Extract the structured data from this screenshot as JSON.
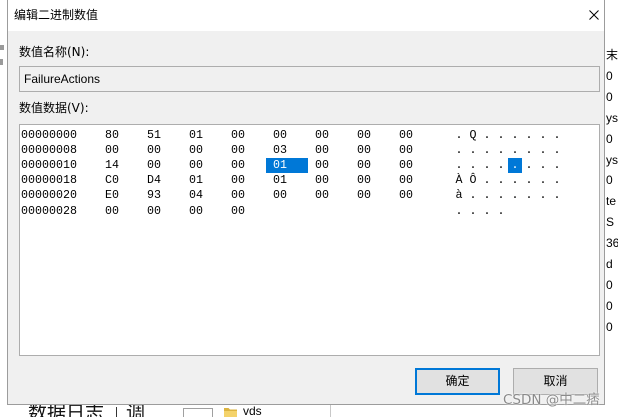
{
  "dialog": {
    "title": "编辑二进制数值",
    "close_icon": "close-icon",
    "value_name_label": "数值名称(N):",
    "value_name": "FailureActions",
    "value_data_label": "数值数据(V):",
    "ok_label": "确定",
    "cancel_label": "取消"
  },
  "hex_editor": {
    "selected": {
      "row": 2,
      "byte": 4
    },
    "rows": [
      {
        "offset": "00000000",
        "bytes": [
          "80",
          "51",
          "01",
          "00",
          "00",
          "00",
          "00",
          "00"
        ],
        "ascii": [
          ".",
          "Q",
          ".",
          ".",
          ".",
          ".",
          ".",
          "."
        ]
      },
      {
        "offset": "00000008",
        "bytes": [
          "00",
          "00",
          "00",
          "00",
          "03",
          "00",
          "00",
          "00"
        ],
        "ascii": [
          ".",
          ".",
          ".",
          ".",
          ".",
          ".",
          ".",
          "."
        ]
      },
      {
        "offset": "00000010",
        "bytes": [
          "14",
          "00",
          "00",
          "00",
          "01",
          "00",
          "00",
          "00"
        ],
        "ascii": [
          ".",
          ".",
          ".",
          ".",
          ".",
          ".",
          ".",
          "."
        ]
      },
      {
        "offset": "00000018",
        "bytes": [
          "C0",
          "D4",
          "01",
          "00",
          "01",
          "00",
          "00",
          "00"
        ],
        "ascii": [
          "À",
          "Ô",
          ".",
          ".",
          ".",
          ".",
          ".",
          "."
        ]
      },
      {
        "offset": "00000020",
        "bytes": [
          "E0",
          "93",
          "04",
          "00",
          "00",
          "00",
          "00",
          "00"
        ],
        "ascii": [
          "à",
          ".",
          ".",
          ".",
          ".",
          ".",
          ".",
          "."
        ]
      },
      {
        "offset": "00000028",
        "bytes": [
          "00",
          "00",
          "00",
          "00"
        ],
        "ascii": [
          ".",
          ".",
          ".",
          "."
        ]
      }
    ]
  },
  "background_window": {
    "right_column": [
      "末",
      "0",
      "0",
      "ys",
      "0",
      "ys",
      "0",
      "te",
      "S",
      "36",
      "d",
      "0",
      "0",
      "0"
    ],
    "bottom_label": "数据日志",
    "bottom_label_2": "调",
    "folder_icon": "folder-icon",
    "folder_name": "vds"
  },
  "watermark": "CSDN @中二痞",
  "colors": {
    "accent": "#0078d7",
    "dialog_bg": "#f0f0f0",
    "button_bg": "#e1e1e1",
    "watermark": "#8a8a8a"
  }
}
